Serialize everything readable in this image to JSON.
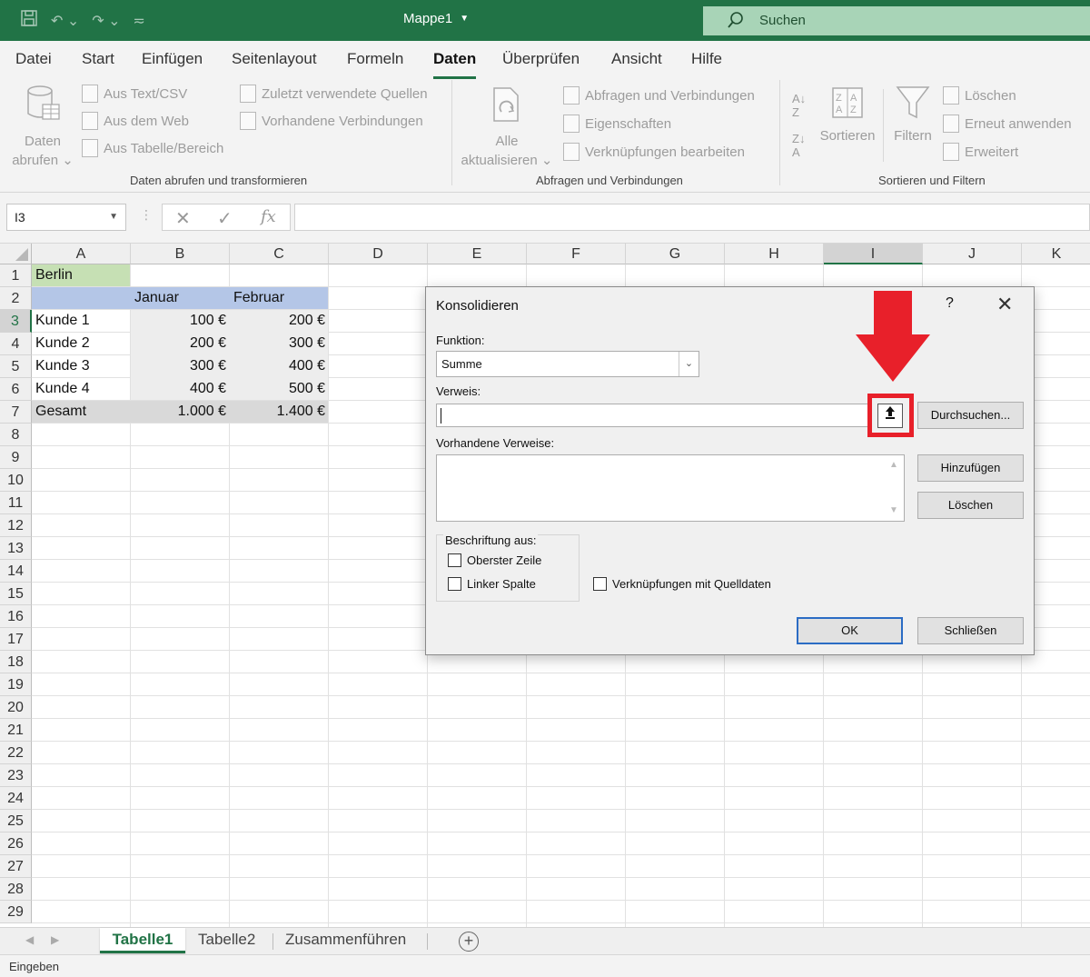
{
  "window": {
    "title": "Mappe1",
    "search_placeholder": "Suchen"
  },
  "ribbon": {
    "tabs": [
      "Datei",
      "Start",
      "Einfügen",
      "Seitenlayout",
      "Formeln",
      "Daten",
      "Überprüfen",
      "Ansicht",
      "Hilfe"
    ],
    "active_tab": "Daten",
    "groups": {
      "get_transform": {
        "label": "Daten abrufen und transformieren",
        "big_button": {
          "line1": "Daten",
          "line2": "abrufen ⌄"
        },
        "buttons": [
          "Aus Text/CSV",
          "Aus dem Web",
          "Aus Tabelle/Bereich",
          "Zuletzt verwendete Quellen",
          "Vorhandene Verbindungen"
        ]
      },
      "queries": {
        "label": "Abfragen und Verbindungen",
        "big_button": {
          "line1": "Alle",
          "line2": "aktualisieren ⌄"
        },
        "buttons": [
          "Abfragen und Verbindungen",
          "Eigenschaften",
          "Verknüpfungen bearbeiten"
        ]
      },
      "sort_filter": {
        "label": "Sortieren und Filtern",
        "sort_label": "Sortieren",
        "filter_label": "Filtern",
        "buttons": [
          "Löschen",
          "Erneut anwenden",
          "Erweitert"
        ]
      }
    }
  },
  "formula_bar": {
    "name_box": "I3",
    "fx": "fx",
    "content": ""
  },
  "sheet": {
    "columns": [
      "A",
      "B",
      "C",
      "D",
      "E",
      "F",
      "G",
      "H",
      "I",
      "J",
      "K"
    ],
    "selected_column": "I",
    "rows": [
      "1",
      "2",
      "3",
      "4",
      "5",
      "6",
      "7",
      "8",
      "9",
      "10",
      "11",
      "12",
      "13",
      "14",
      "15",
      "16",
      "17",
      "18",
      "19",
      "20",
      "21",
      "22",
      "23",
      "24",
      "25",
      "26",
      "27",
      "28",
      "29"
    ],
    "selected_row": "3",
    "cells": {
      "A1": "Berlin",
      "B2": "Januar",
      "C2": "Februar",
      "A3": "Kunde 1",
      "B3": "100 €",
      "C3": "200 €",
      "A4": "Kunde 2",
      "B4": "200 €",
      "C4": "300 €",
      "A5": "Kunde 3",
      "B5": "300 €",
      "C5": "400 €",
      "A6": "Kunde 4",
      "B6": "400 €",
      "C6": "500 €",
      "A7": "Gesamt",
      "B7": "1.000 €",
      "C7": "1.400 €"
    },
    "colors": {
      "header_green": "#c6e0b4",
      "header_blue": "#b4c6e7",
      "data_gray": "#ededed",
      "total_gray": "#d9d9d9"
    }
  },
  "dialog": {
    "title": "Konsolidieren",
    "help": "?",
    "close": "✕",
    "function_label": "Funktion:",
    "function_value": "Summe",
    "reference_label": "Verweis:",
    "reference_value": "",
    "browse_button": "Durchsuchen...",
    "existing_label": "Vorhandene Verweise:",
    "add_button": "Hinzufügen",
    "delete_button": "Löschen",
    "labels_group": "Beschriftung aus:",
    "top_row": "Oberster Zeile",
    "left_column": "Linker Spalte",
    "link_source": "Verknüpfungen mit Quelldaten",
    "ok_button": "OK",
    "close_button": "Schließen",
    "highlight_color": "#e8202a"
  },
  "sheet_tabs": [
    "Tabelle1",
    "Tabelle2",
    "Zusammenführen"
  ],
  "active_sheet": "Tabelle1",
  "status": "Eingeben"
}
